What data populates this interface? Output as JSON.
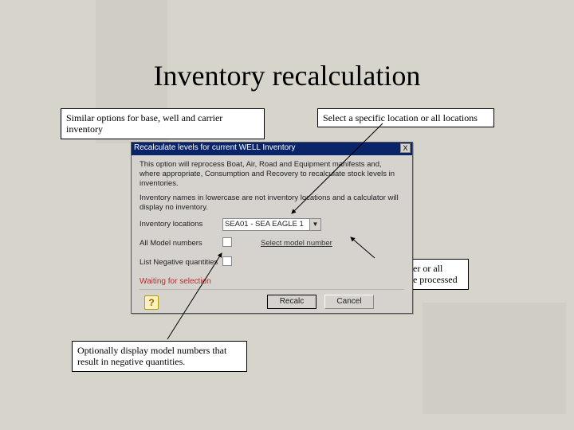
{
  "slide": {
    "title": "Inventory recalculation"
  },
  "annotations": {
    "top_left": "Similar options for base, well and carrier inventory",
    "top_right": "Select a specific location or all locations",
    "mid_right": "A single model number or all model numbers can be processed",
    "bottom_left": "Optionally display model numbers that result in negative quantities."
  },
  "dialog": {
    "title": "Recalculate levels for current WELL Inventory",
    "close_x": "X",
    "intro1": "This option will reprocess Boat, Air, Road and Equipment manifests and, where appropriate, Consumption and Recovery to recalculate stock levels in inventories.",
    "intro2": "Inventory names in lowercase are not inventory locations and a calculator will display no inventory.",
    "labels": {
      "location": "Inventory locations",
      "all_models": "All Model numbers",
      "list_negative": "List Negative quantities"
    },
    "fields": {
      "location_value": "SEA01 - SEA EAGLE 1",
      "model_select_text": "Select model number"
    },
    "status": "Waiting for selection",
    "buttons": {
      "recalc": "Recalc",
      "cancel": "Cancel",
      "help": "?"
    }
  }
}
